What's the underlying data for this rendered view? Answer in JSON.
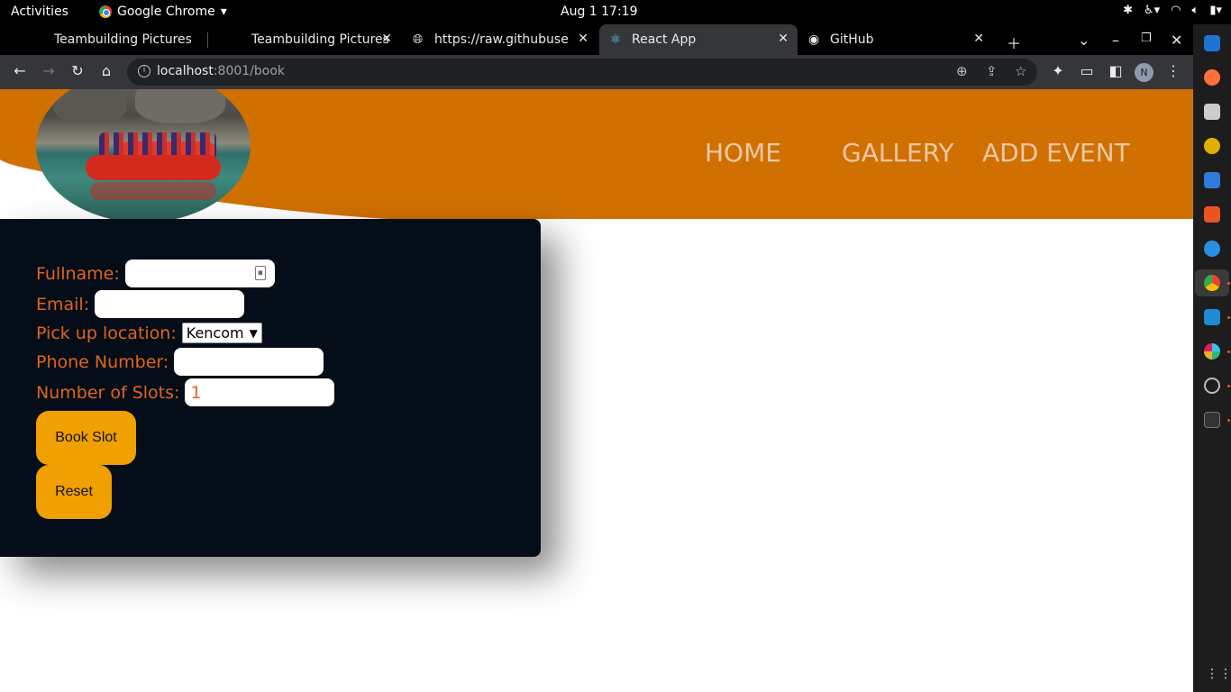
{
  "system_bar": {
    "activities": "Activities",
    "app_name": "Google Chrome",
    "clock": "Aug 1  17:19"
  },
  "tabs": [
    {
      "title": "Teambuilding Pictures",
      "active": false
    },
    {
      "title": "Teambuilding Pictures",
      "active": false
    },
    {
      "title": "https://raw.githubuse",
      "active": false
    },
    {
      "title": "React App",
      "active": true
    },
    {
      "title": "GitHub",
      "active": false
    }
  ],
  "address_bar": {
    "host": "localhost",
    "path": ":8001/book"
  },
  "profile_initial": "N",
  "nav": {
    "home": "HOME",
    "gallery": "GALLERY",
    "add_event": "ADD EVENT"
  },
  "form": {
    "fullname_label": "Fullname:",
    "fullname_value": "",
    "email_label": "Email:",
    "email_value": "",
    "pickup_label": "Pick up location:",
    "pickup_selected": "Kencom",
    "phone_label": "Phone Number:",
    "phone_value": "",
    "slots_label": "Number of Slots:",
    "slots_value": "1",
    "book_button": "Book Slot",
    "reset_button": "Reset"
  },
  "colors": {
    "header_orange": "#d07000",
    "form_bg": "#050d18",
    "label_orange": "#e1641c",
    "button_yellow": "#f0a000"
  }
}
